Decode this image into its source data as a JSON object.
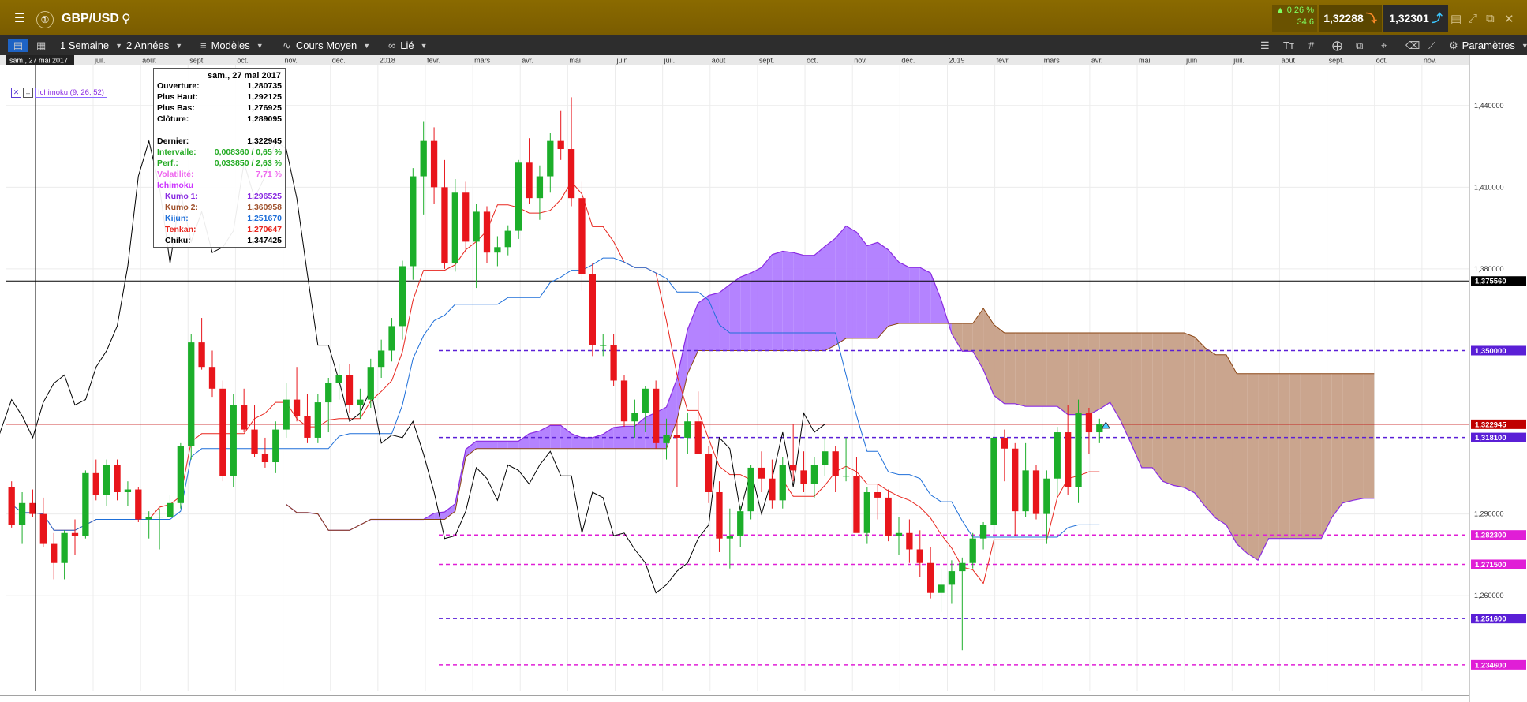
{
  "header": {
    "symbol": "GBP/USD",
    "change_pct": "▲ 0,26 %",
    "change_pts": "34,6",
    "bid": "1,32288",
    "ask": "1,32301",
    "colors": {
      "bar": "#7a5c00",
      "up": "#7fff5f"
    }
  },
  "toolbar": {
    "period": "1 Semaine",
    "range": "2 Années",
    "models": "Modèles",
    "price_type": "Cours Moyen",
    "link": "Lié",
    "settings": "Paramètres"
  },
  "tooltip": {
    "date": "sam., 27 mai 2017",
    "rows": [
      {
        "k": "Ouverture:",
        "v": "1,280735",
        "color": "#000000"
      },
      {
        "k": "Plus Haut:",
        "v": "1,292125",
        "color": "#000000"
      },
      {
        "k": "Plus Bas:",
        "v": "1,276925",
        "color": "#000000"
      },
      {
        "k": "Clôture:",
        "v": "1,289095",
        "color": "#000000"
      },
      {
        "k": "Dernier:",
        "v": "1,322945",
        "color": "#000000"
      },
      {
        "k": "Intervalle:",
        "v": "0,008360 / 0,65 %",
        "color": "#22aa22"
      },
      {
        "k": "Perf.:",
        "v": "0,033850 / 2,63 %",
        "color": "#22aa22"
      },
      {
        "k": "Volatilité:",
        "v": "7,71 %",
        "color": "#ee66ee"
      },
      {
        "k": "Ichimoku",
        "v": "",
        "color": "#cc33ff"
      },
      {
        "k": "  Kumo 1:",
        "v": "1,296525",
        "color": "#8a2be2"
      },
      {
        "k": "  Kumo 2:",
        "v": "1,360958",
        "color": "#a0522d"
      },
      {
        "k": "  Kijun:",
        "v": "1,251670",
        "color": "#1e6fd9"
      },
      {
        "k": "  Tenkan:",
        "v": "1,270647",
        "color": "#e8261e"
      },
      {
        "k": "  Chiku:",
        "v": "1,347425",
        "color": "#000000"
      }
    ]
  },
  "indicator_label": "Ichimoku (9, 26, 52)",
  "cursor_date": "sam., 27 mai 2017",
  "chart_data": {
    "type": "candlestick",
    "instrument": "GBP/USD",
    "period": "1 Semaine",
    "ylim": [
      1.225,
      1.455
    ],
    "y_ticks": [
      "1,440000",
      "1,410000",
      "1,380000",
      "1,290000",
      "1,260000"
    ],
    "x_labels": [
      "juil.",
      "août",
      "sept.",
      "oct.",
      "nov.",
      "déc.",
      "2018",
      "févr.",
      "mars",
      "avr.",
      "mai",
      "juin",
      "juil.",
      "août",
      "sept.",
      "oct.",
      "nov.",
      "déc.",
      "2019",
      "févr.",
      "mars",
      "avr.",
      "mai",
      "juin",
      "juil.",
      "août",
      "sept.",
      "oct.",
      "nov."
    ],
    "candles": [
      [
        1.3,
        1.302,
        1.285,
        1.286
      ],
      [
        1.286,
        1.298,
        1.279,
        1.294
      ],
      [
        1.294,
        1.299,
        1.289,
        1.29
      ],
      [
        1.29,
        1.296,
        1.278,
        1.279
      ],
      [
        1.279,
        1.283,
        1.266,
        1.272
      ],
      [
        1.272,
        1.284,
        1.266,
        1.283
      ],
      [
        1.283,
        1.288,
        1.275,
        1.282
      ],
      [
        1.282,
        1.306,
        1.281,
        1.305
      ],
      [
        1.305,
        1.31,
        1.295,
        1.297
      ],
      [
        1.297,
        1.31,
        1.293,
        1.308
      ],
      [
        1.308,
        1.31,
        1.295,
        1.298
      ],
      [
        1.298,
        1.302,
        1.293,
        1.299
      ],
      [
        1.299,
        1.3,
        1.287,
        1.288
      ],
      [
        1.288,
        1.291,
        1.281,
        1.289
      ],
      [
        1.289,
        1.292,
        1.277,
        1.289
      ],
      [
        1.289,
        1.297,
        1.288,
        1.294
      ],
      [
        1.294,
        1.316,
        1.292,
        1.315
      ],
      [
        1.315,
        1.356,
        1.31,
        1.353
      ],
      [
        1.353,
        1.362,
        1.343,
        1.344
      ],
      [
        1.344,
        1.35,
        1.333,
        1.336
      ],
      [
        1.336,
        1.339,
        1.302,
        1.304
      ],
      [
        1.304,
        1.334,
        1.3,
        1.33
      ],
      [
        1.33,
        1.336,
        1.32,
        1.321
      ],
      [
        1.321,
        1.33,
        1.311,
        1.312
      ],
      [
        1.312,
        1.318,
        1.307,
        1.309
      ],
      [
        1.309,
        1.324,
        1.305,
        1.321
      ],
      [
        1.321,
        1.338,
        1.318,
        1.332
      ],
      [
        1.332,
        1.344,
        1.324,
        1.326
      ],
      [
        1.326,
        1.334,
        1.316,
        1.318
      ],
      [
        1.318,
        1.334,
        1.316,
        1.331
      ],
      [
        1.331,
        1.34,
        1.32,
        1.338
      ],
      [
        1.338,
        1.345,
        1.332,
        1.341
      ],
      [
        1.341,
        1.345,
        1.327,
        1.33
      ],
      [
        1.33,
        1.336,
        1.325,
        1.332
      ],
      [
        1.332,
        1.347,
        1.329,
        1.344
      ],
      [
        1.344,
        1.354,
        1.34,
        1.35
      ],
      [
        1.35,
        1.362,
        1.346,
        1.359
      ],
      [
        1.359,
        1.383,
        1.354,
        1.381
      ],
      [
        1.381,
        1.417,
        1.376,
        1.414
      ],
      [
        1.414,
        1.434,
        1.4,
        1.427
      ],
      [
        1.427,
        1.432,
        1.404,
        1.41
      ],
      [
        1.41,
        1.42,
        1.38,
        1.382
      ],
      [
        1.382,
        1.413,
        1.379,
        1.408
      ],
      [
        1.408,
        1.412,
        1.386,
        1.39
      ],
      [
        1.39,
        1.404,
        1.373,
        1.401
      ],
      [
        1.401,
        1.403,
        1.382,
        1.386
      ],
      [
        1.386,
        1.392,
        1.381,
        1.388
      ],
      [
        1.388,
        1.396,
        1.385,
        1.394
      ],
      [
        1.394,
        1.42,
        1.391,
        1.419
      ],
      [
        1.419,
        1.428,
        1.404,
        1.406
      ],
      [
        1.406,
        1.418,
        1.398,
        1.414
      ],
      [
        1.414,
        1.43,
        1.408,
        1.427
      ],
      [
        1.427,
        1.438,
        1.42,
        1.424
      ],
      [
        1.424,
        1.443,
        1.403,
        1.406
      ],
      [
        1.406,
        1.412,
        1.372,
        1.378
      ],
      [
        1.378,
        1.382,
        1.348,
        1.352
      ],
      [
        1.352,
        1.356,
        1.348,
        1.352
      ],
      [
        1.352,
        1.356,
        1.337,
        1.339
      ],
      [
        1.339,
        1.341,
        1.322,
        1.324
      ],
      [
        1.324,
        1.332,
        1.318,
        1.327
      ],
      [
        1.327,
        1.337,
        1.32,
        1.336
      ],
      [
        1.336,
        1.339,
        1.314,
        1.316
      ],
      [
        1.316,
        1.325,
        1.31,
        1.319
      ],
      [
        1.319,
        1.325,
        1.3,
        1.318
      ],
      [
        1.318,
        1.327,
        1.312,
        1.324
      ],
      [
        1.324,
        1.335,
        1.318,
        1.312
      ],
      [
        1.312,
        1.315,
        1.294,
        1.298
      ],
      [
        1.298,
        1.302,
        1.276,
        1.281
      ],
      [
        1.281,
        1.292,
        1.27,
        1.282
      ],
      [
        1.282,
        1.293,
        1.278,
        1.291
      ],
      [
        1.291,
        1.308,
        1.288,
        1.307
      ],
      [
        1.307,
        1.313,
        1.298,
        1.303
      ],
      [
        1.303,
        1.31,
        1.292,
        1.295
      ],
      [
        1.295,
        1.311,
        1.292,
        1.308
      ],
      [
        1.308,
        1.323,
        1.302,
        1.306
      ],
      [
        1.306,
        1.313,
        1.298,
        1.301
      ],
      [
        1.301,
        1.311,
        1.296,
        1.308
      ],
      [
        1.308,
        1.318,
        1.304,
        1.313
      ],
      [
        1.313,
        1.315,
        1.298,
        1.304
      ],
      [
        1.304,
        1.318,
        1.302,
        1.304
      ],
      [
        1.304,
        1.311,
        1.288,
        1.283
      ],
      [
        1.283,
        1.3,
        1.279,
        1.298
      ],
      [
        1.298,
        1.301,
        1.288,
        1.296
      ],
      [
        1.296,
        1.299,
        1.28,
        1.282
      ],
      [
        1.282,
        1.289,
        1.275,
        1.283
      ],
      [
        1.283,
        1.288,
        1.272,
        1.277
      ],
      [
        1.277,
        1.284,
        1.267,
        1.272
      ],
      [
        1.272,
        1.278,
        1.259,
        1.261
      ],
      [
        1.261,
        1.27,
        1.254,
        1.264
      ],
      [
        1.264,
        1.273,
        1.257,
        1.269
      ],
      [
        1.269,
        1.274,
        1.24,
        1.272
      ],
      [
        1.272,
        1.283,
        1.27,
        1.281
      ],
      [
        1.281,
        1.287,
        1.277,
        1.286
      ],
      [
        1.286,
        1.321,
        1.276,
        1.318
      ],
      [
        1.318,
        1.321,
        1.302,
        1.314
      ],
      [
        1.314,
        1.316,
        1.282,
        1.291
      ],
      [
        1.291,
        1.316,
        1.289,
        1.306
      ],
      [
        1.306,
        1.308,
        1.288,
        1.29
      ],
      [
        1.29,
        1.306,
        1.279,
        1.303
      ],
      [
        1.303,
        1.322,
        1.297,
        1.32
      ],
      [
        1.32,
        1.33,
        1.297,
        1.3
      ],
      [
        1.3,
        1.332,
        1.294,
        1.327
      ],
      [
        1.327,
        1.329,
        1.312,
        1.32
      ],
      [
        1.32,
        1.325,
        1.316,
        1.323
      ]
    ],
    "horizontal_levels": [
      {
        "value": 1.37556,
        "label": "1,375560",
        "color": "#000000",
        "style": "solid"
      },
      {
        "value": 1.322945,
        "label": "1,322945",
        "color": "#c00000",
        "style": "solid"
      },
      {
        "value": 1.35,
        "label": "1,350000",
        "color": "#5a1fd6",
        "style": "dashed"
      },
      {
        "value": 1.3181,
        "label": "1,318100",
        "color": "#5a1fd6",
        "style": "dashed"
      },
      {
        "value": 1.2823,
        "label": "1,282300",
        "color": "#e01ed6",
        "style": "dashed"
      },
      {
        "value": 1.2715,
        "label": "1,271500",
        "color": "#e01ed6",
        "style": "dashed"
      },
      {
        "value": 1.2516,
        "label": "1,251600",
        "color": "#5a1fd6",
        "style": "dashed"
      },
      {
        "value": 1.2346,
        "label": "1,234600",
        "color": "#e01ed6",
        "style": "dashed"
      }
    ],
    "ichimoku": {
      "params": [
        9,
        26,
        52
      ],
      "tenkan_color": "#e8261e",
      "kijun_color": "#1e6fd9",
      "chikou_color": "#000000",
      "kumo_bull_color": "#b07cff",
      "kumo_bear_color": "#c7a088"
    }
  }
}
